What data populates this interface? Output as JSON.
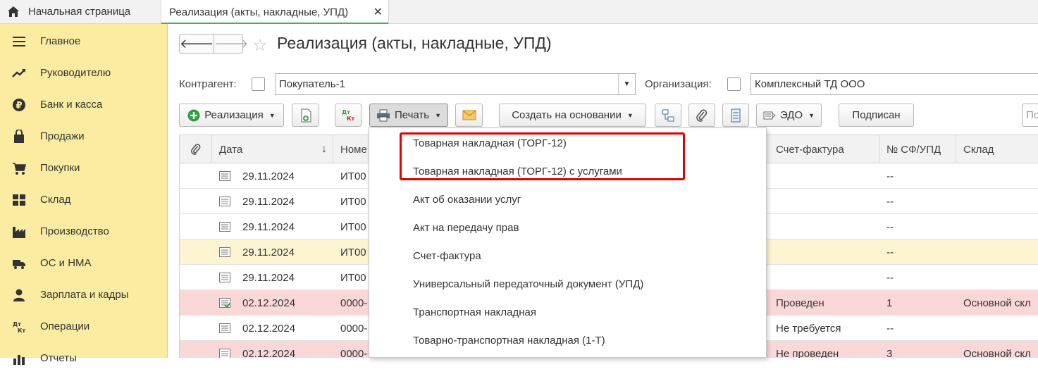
{
  "tabs": {
    "home_label": "Начальная страница",
    "active_label": "Реализация (акты, накладные, УПД)",
    "close_symbol": "✕"
  },
  "sidebar": {
    "items": [
      {
        "label": "Главное",
        "icon": "menu-icon"
      },
      {
        "label": "Руководителю",
        "icon": "trend-icon"
      },
      {
        "label": "Банк и касса",
        "icon": "ruble-icon"
      },
      {
        "label": "Продажи",
        "icon": "bag-icon"
      },
      {
        "label": "Покупки",
        "icon": "cart-icon"
      },
      {
        "label": "Склад",
        "icon": "warehouse-icon"
      },
      {
        "label": "Производство",
        "icon": "factory-icon"
      },
      {
        "label": "ОС и НМА",
        "icon": "truck-icon"
      },
      {
        "label": "Зарплата и кадры",
        "icon": "person-icon"
      },
      {
        "label": "Операции",
        "icon": "dt-kt-icon"
      },
      {
        "label": "Отчеты",
        "icon": "chart-icon"
      }
    ]
  },
  "page": {
    "title": "Реализация (акты, накладные, УПД)"
  },
  "filters": {
    "counterparty_label": "Контрагент:",
    "counterparty_value": "Покупатель-1",
    "organization_label": "Организация:",
    "organization_value": "Комплексный ТД ООО"
  },
  "toolbar": {
    "sale_label": "Реализация",
    "print_label": "Печать",
    "create_based_label": "Создать на основании",
    "edo_label": "ЭДО",
    "signed_label": "Подписан",
    "search_placeholder": "По",
    "dt_label": "Дт",
    "kt_label": "Кт"
  },
  "table": {
    "headers": {
      "date": "Дата",
      "number": "Номе",
      "invoice": "Счет-фактура",
      "sf_number": "№ СФ/УПД",
      "warehouse": "Склад"
    },
    "sort_arrow": "↓",
    "rows": [
      {
        "date": "29.11.2024",
        "number": "ИТ00",
        "invoice": "",
        "sf": "--",
        "warehouse": "",
        "style": "normal",
        "posted": false
      },
      {
        "date": "29.11.2024",
        "number": "ИТ00",
        "invoice": "",
        "sf": "--",
        "warehouse": "",
        "style": "normal",
        "posted": false
      },
      {
        "date": "29.11.2024",
        "number": "ИТ00",
        "invoice": "",
        "sf": "--",
        "warehouse": "",
        "style": "normal",
        "posted": false
      },
      {
        "date": "29.11.2024",
        "number": "ИТ00",
        "invoice": "",
        "sf": "--",
        "warehouse": "",
        "style": "sel",
        "posted": false
      },
      {
        "date": "29.11.2024",
        "number": "ИТ00",
        "invoice": "",
        "sf": "--",
        "warehouse": "",
        "style": "normal",
        "posted": false
      },
      {
        "date": "02.12.2024",
        "number": "0000-",
        "invoice": "Проведен",
        "sf": "1",
        "warehouse": "Основной скл",
        "style": "red",
        "posted": true
      },
      {
        "date": "02.12.2024",
        "number": "0000-",
        "invoice": "Не требуется",
        "sf": "--",
        "warehouse": "",
        "style": "normal",
        "posted": false
      },
      {
        "date": "02.12.2024",
        "number": "0000-",
        "invoice": "Не проведен",
        "sf": "3",
        "warehouse": "Основной скл",
        "style": "red",
        "posted": false
      }
    ]
  },
  "print_menu": {
    "items": [
      "Товарная накладная (ТОРГ-12)",
      "Товарная накладная (ТОРГ-12) с услугами",
      "Акт об оказании услуг",
      "Акт на передачу прав",
      "Счет-фактура",
      "Универсальный передаточный документ (УПД)",
      "Транспортная накладная",
      "Товарно-транспортная накладная (1-Т)"
    ]
  },
  "colors": {
    "sidebar_bg": "#fbeca1",
    "accent_green": "#4caf50",
    "highlight_red": "#e00000",
    "row_selected": "#fdf5d2",
    "row_red": "#fbd8d8"
  }
}
